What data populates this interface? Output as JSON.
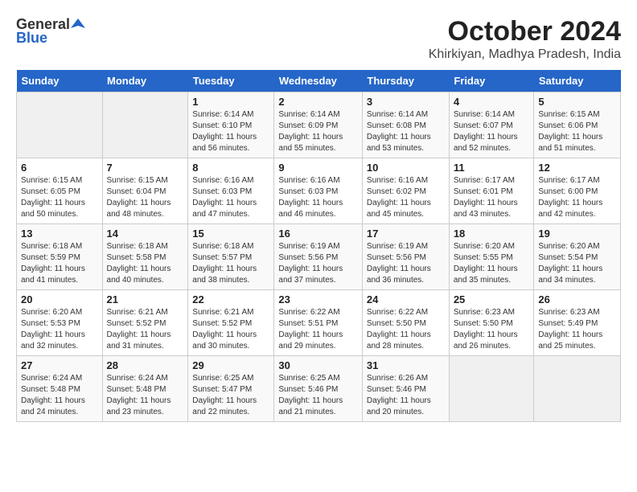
{
  "logo": {
    "general": "General",
    "blue": "Blue"
  },
  "title": "October 2024",
  "location": "Khirkiyan, Madhya Pradesh, India",
  "weekdays": [
    "Sunday",
    "Monday",
    "Tuesday",
    "Wednesday",
    "Thursday",
    "Friday",
    "Saturday"
  ],
  "weeks": [
    [
      {
        "day": "",
        "info": ""
      },
      {
        "day": "",
        "info": ""
      },
      {
        "day": "1",
        "info": "Sunrise: 6:14 AM\nSunset: 6:10 PM\nDaylight: 11 hours and 56 minutes."
      },
      {
        "day": "2",
        "info": "Sunrise: 6:14 AM\nSunset: 6:09 PM\nDaylight: 11 hours and 55 minutes."
      },
      {
        "day": "3",
        "info": "Sunrise: 6:14 AM\nSunset: 6:08 PM\nDaylight: 11 hours and 53 minutes."
      },
      {
        "day": "4",
        "info": "Sunrise: 6:14 AM\nSunset: 6:07 PM\nDaylight: 11 hours and 52 minutes."
      },
      {
        "day": "5",
        "info": "Sunrise: 6:15 AM\nSunset: 6:06 PM\nDaylight: 11 hours and 51 minutes."
      }
    ],
    [
      {
        "day": "6",
        "info": "Sunrise: 6:15 AM\nSunset: 6:05 PM\nDaylight: 11 hours and 50 minutes."
      },
      {
        "day": "7",
        "info": "Sunrise: 6:15 AM\nSunset: 6:04 PM\nDaylight: 11 hours and 48 minutes."
      },
      {
        "day": "8",
        "info": "Sunrise: 6:16 AM\nSunset: 6:03 PM\nDaylight: 11 hours and 47 minutes."
      },
      {
        "day": "9",
        "info": "Sunrise: 6:16 AM\nSunset: 6:03 PM\nDaylight: 11 hours and 46 minutes."
      },
      {
        "day": "10",
        "info": "Sunrise: 6:16 AM\nSunset: 6:02 PM\nDaylight: 11 hours and 45 minutes."
      },
      {
        "day": "11",
        "info": "Sunrise: 6:17 AM\nSunset: 6:01 PM\nDaylight: 11 hours and 43 minutes."
      },
      {
        "day": "12",
        "info": "Sunrise: 6:17 AM\nSunset: 6:00 PM\nDaylight: 11 hours and 42 minutes."
      }
    ],
    [
      {
        "day": "13",
        "info": "Sunrise: 6:18 AM\nSunset: 5:59 PM\nDaylight: 11 hours and 41 minutes."
      },
      {
        "day": "14",
        "info": "Sunrise: 6:18 AM\nSunset: 5:58 PM\nDaylight: 11 hours and 40 minutes."
      },
      {
        "day": "15",
        "info": "Sunrise: 6:18 AM\nSunset: 5:57 PM\nDaylight: 11 hours and 38 minutes."
      },
      {
        "day": "16",
        "info": "Sunrise: 6:19 AM\nSunset: 5:56 PM\nDaylight: 11 hours and 37 minutes."
      },
      {
        "day": "17",
        "info": "Sunrise: 6:19 AM\nSunset: 5:56 PM\nDaylight: 11 hours and 36 minutes."
      },
      {
        "day": "18",
        "info": "Sunrise: 6:20 AM\nSunset: 5:55 PM\nDaylight: 11 hours and 35 minutes."
      },
      {
        "day": "19",
        "info": "Sunrise: 6:20 AM\nSunset: 5:54 PM\nDaylight: 11 hours and 34 minutes."
      }
    ],
    [
      {
        "day": "20",
        "info": "Sunrise: 6:20 AM\nSunset: 5:53 PM\nDaylight: 11 hours and 32 minutes."
      },
      {
        "day": "21",
        "info": "Sunrise: 6:21 AM\nSunset: 5:52 PM\nDaylight: 11 hours and 31 minutes."
      },
      {
        "day": "22",
        "info": "Sunrise: 6:21 AM\nSunset: 5:52 PM\nDaylight: 11 hours and 30 minutes."
      },
      {
        "day": "23",
        "info": "Sunrise: 6:22 AM\nSunset: 5:51 PM\nDaylight: 11 hours and 29 minutes."
      },
      {
        "day": "24",
        "info": "Sunrise: 6:22 AM\nSunset: 5:50 PM\nDaylight: 11 hours and 28 minutes."
      },
      {
        "day": "25",
        "info": "Sunrise: 6:23 AM\nSunset: 5:50 PM\nDaylight: 11 hours and 26 minutes."
      },
      {
        "day": "26",
        "info": "Sunrise: 6:23 AM\nSunset: 5:49 PM\nDaylight: 11 hours and 25 minutes."
      }
    ],
    [
      {
        "day": "27",
        "info": "Sunrise: 6:24 AM\nSunset: 5:48 PM\nDaylight: 11 hours and 24 minutes."
      },
      {
        "day": "28",
        "info": "Sunrise: 6:24 AM\nSunset: 5:48 PM\nDaylight: 11 hours and 23 minutes."
      },
      {
        "day": "29",
        "info": "Sunrise: 6:25 AM\nSunset: 5:47 PM\nDaylight: 11 hours and 22 minutes."
      },
      {
        "day": "30",
        "info": "Sunrise: 6:25 AM\nSunset: 5:46 PM\nDaylight: 11 hours and 21 minutes."
      },
      {
        "day": "31",
        "info": "Sunrise: 6:26 AM\nSunset: 5:46 PM\nDaylight: 11 hours and 20 minutes."
      },
      {
        "day": "",
        "info": ""
      },
      {
        "day": "",
        "info": ""
      }
    ]
  ]
}
